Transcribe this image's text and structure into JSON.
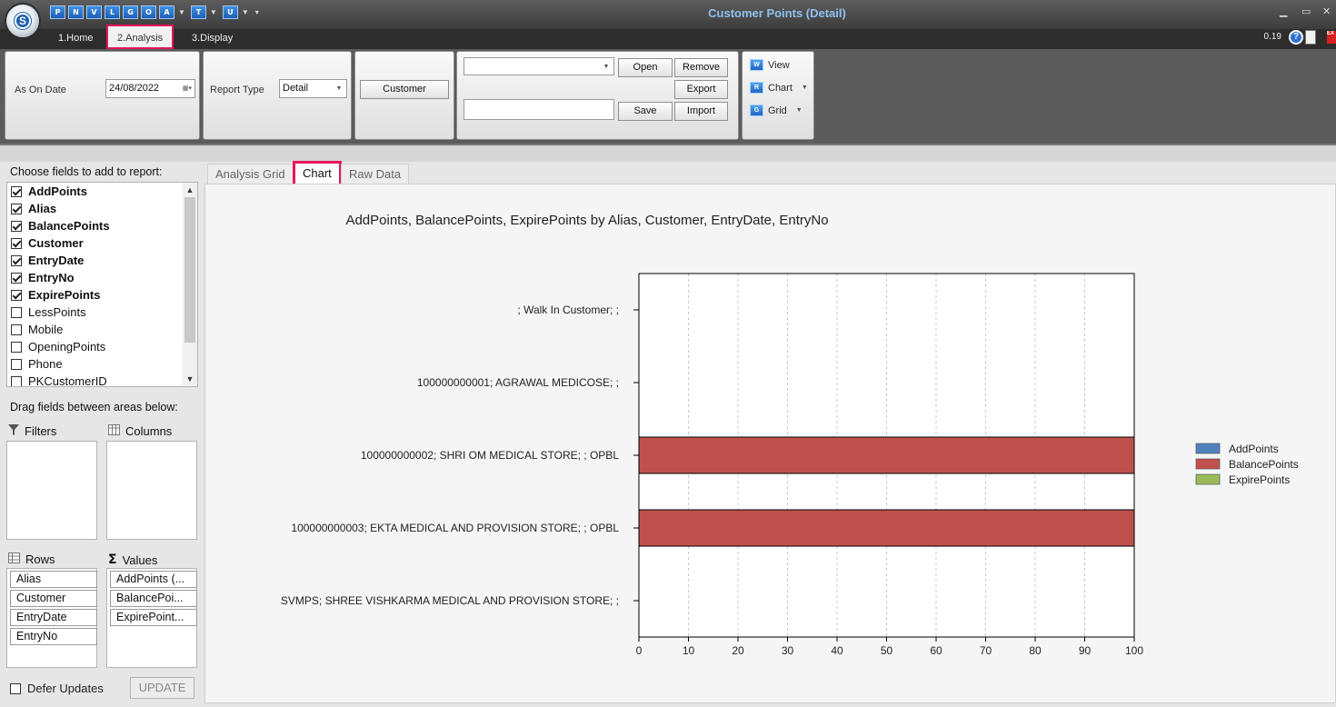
{
  "window": {
    "title": "Customer Points (Detail)"
  },
  "quick_access": [
    "P",
    "N",
    "V",
    "L",
    "G",
    "O",
    "A",
    "T",
    "U"
  ],
  "menu_tabs": [
    "1.Home",
    "2.Analysis",
    "3.Display"
  ],
  "active_menu_tab": "2.Analysis",
  "version": "0.19",
  "ribbon": {
    "as_on_date_label": "As On Date",
    "as_on_date_value": "24/08/2022",
    "report_type_label": "Report Type",
    "report_type_value": "Detail",
    "customer_button": "Customer",
    "open_button": "Open",
    "remove_button": "Remove",
    "export_button": "Export",
    "save_button": "Save",
    "import_button": "Import",
    "view_label": "View",
    "chart_label": "Chart",
    "grid_label": "Grid"
  },
  "left_panel": {
    "choose_fields_title": "Choose fields to add to report:",
    "fields": [
      {
        "name": "AddPoints",
        "checked": true
      },
      {
        "name": "Alias",
        "checked": true
      },
      {
        "name": "BalancePoints",
        "checked": true
      },
      {
        "name": "Customer",
        "checked": true
      },
      {
        "name": "EntryDate",
        "checked": true
      },
      {
        "name": "EntryNo",
        "checked": true
      },
      {
        "name": "ExpirePoints",
        "checked": true
      },
      {
        "name": "LessPoints",
        "checked": false
      },
      {
        "name": "Mobile",
        "checked": false
      },
      {
        "name": "OpeningPoints",
        "checked": false
      },
      {
        "name": "Phone",
        "checked": false
      },
      {
        "name": "PKCustomerID",
        "checked": false
      }
    ],
    "drag_title": "Drag fields between areas below:",
    "filters_label": "Filters",
    "columns_label": "Columns",
    "rows_label": "Rows",
    "values_label": "Values",
    "rows": [
      "Alias",
      "Customer",
      "EntryDate",
      "EntryNo"
    ],
    "values": [
      "AddPoints (...",
      "BalancePoi...",
      "ExpirePoint..."
    ],
    "defer_updates_label": "Defer Updates",
    "update_button": "UPDATE"
  },
  "content_tabs": [
    "Analysis Grid",
    "Chart",
    "Raw Data"
  ],
  "active_content_tab": "Chart",
  "colors": {
    "AddPoints": "#4f81bd",
    "BalancePoints": "#c0504d",
    "ExpirePoints": "#9bbb59",
    "accent": "#e8155f"
  },
  "chart_data": {
    "type": "bar",
    "orientation": "horizontal",
    "title": "AddPoints, BalancePoints, ExpirePoints by Alias, Customer, EntryDate, EntryNo",
    "categories": [
      "; Walk In Customer; ;",
      "100000000001; AGRAWAL MEDICOSE; ;",
      "100000000002; SHRI OM MEDICAL STORE; ; OPBL",
      "100000000003; EKTA MEDICAL AND PROVISION STORE; ; OPBL",
      "SVMPS; SHREE VISHKARMA MEDICAL AND PROVISION STORE; ;"
    ],
    "series": [
      {
        "name": "AddPoints",
        "values": [
          0,
          0,
          0,
          0,
          0
        ]
      },
      {
        "name": "BalancePoints",
        "values": [
          0,
          0,
          100,
          100,
          0
        ]
      },
      {
        "name": "ExpirePoints",
        "values": [
          0,
          0,
          0,
          0,
          0
        ]
      }
    ],
    "xlim": [
      0,
      100
    ],
    "xticks": [
      0,
      10,
      20,
      30,
      40,
      50,
      60,
      70,
      80,
      90,
      100
    ],
    "grid": "vertical dashed",
    "legend_position": "right"
  }
}
